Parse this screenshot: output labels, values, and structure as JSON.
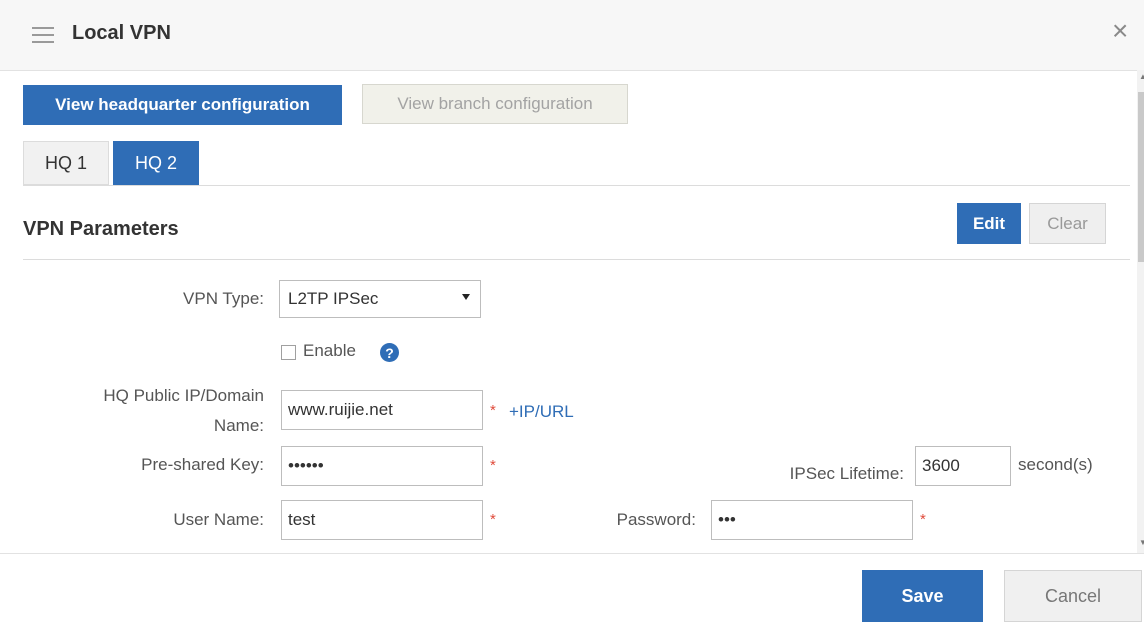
{
  "window": {
    "title": "Local VPN",
    "menu_icon": "hamburger-menu-icon",
    "close_glyph": "×"
  },
  "view_buttons": {
    "headquarter": "View headquarter configuration",
    "branch": "View branch configuration"
  },
  "tabs": [
    {
      "label": "HQ 1",
      "active": false
    },
    {
      "label": "HQ 2",
      "active": true
    }
  ],
  "section": {
    "title": "VPN Parameters",
    "edit_label": "Edit",
    "clear_label": "Clear"
  },
  "form": {
    "vpn_type_label": "VPN Type:",
    "vpn_type_value": "L2TP IPSec",
    "enable_label": "Enable",
    "enable_checked": false,
    "hq_ip_label_line1": "HQ Public IP/Domain",
    "hq_ip_label_line2": "Name:",
    "hq_ip_value": "www.ruijie.net",
    "add_ip_link": "+IP/URL",
    "psk_label": "Pre-shared Key:",
    "psk_value": "••••••",
    "ipsec_lifetime_label": "IPSec Lifetime:",
    "ipsec_lifetime_value": "3600",
    "ipsec_lifetime_unit": "second(s)",
    "username_label": "User Name:",
    "username_value": "test",
    "password_label": "Password:",
    "password_value": "•••",
    "required_mark": "*"
  },
  "footer": {
    "save_label": "Save",
    "cancel_label": "Cancel"
  },
  "colors": {
    "accent": "#2f6db6",
    "required": "#e04b3b"
  }
}
